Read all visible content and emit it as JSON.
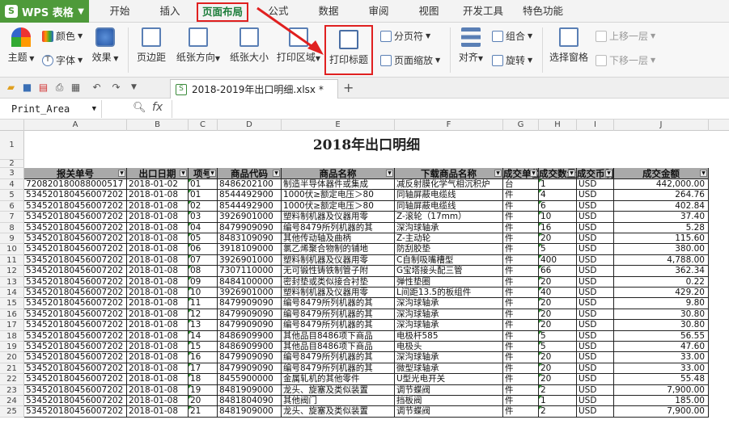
{
  "app": {
    "name": "WPS 表格"
  },
  "menu": {
    "tabs": [
      "开始",
      "插入",
      "页面布局",
      "公式",
      "数据",
      "审阅",
      "视图",
      "开发工具",
      "特色功能"
    ],
    "active_tab": "页面布局"
  },
  "ribbon": {
    "theme": "主题",
    "colors": "颜色",
    "fonts": "字体",
    "effects": "效果",
    "margins": "页边距",
    "orientation": "纸张方向",
    "size": "纸张大小",
    "print_area": "打印区域",
    "print_titles": "打印标题",
    "page_break": "分页符",
    "page_zoom": "页面缩放",
    "align": "对齐",
    "group": "组合",
    "rotate": "旋转",
    "selection_pane": "选择窗格",
    "bring_forward": "上移一层",
    "send_backward": "下移一层"
  },
  "document": {
    "tab_name": "2018-2019年出口明细.xlsx *"
  },
  "formula_bar": {
    "name_box": "Print_Area",
    "fx": "fx"
  },
  "sheet": {
    "columns": [
      "A",
      "B",
      "C",
      "D",
      "E",
      "F",
      "G",
      "H",
      "I",
      "J"
    ],
    "row_numbers": [
      "1",
      "2",
      "3",
      "4",
      "5",
      "6",
      "7",
      "8",
      "9",
      "10",
      "11",
      "12",
      "13",
      "14",
      "15",
      "16",
      "17",
      "18",
      "19",
      "20",
      "21",
      "22",
      "23",
      "24",
      "25"
    ],
    "title": "2018年出口明细",
    "headers": [
      "报关单号",
      "出口日期",
      "项号",
      "商品代码",
      "商品名称",
      "下载商品名称",
      "成交单位",
      "成交数量",
      "成交币制",
      "成交金额"
    ],
    "rows": [
      [
        "720820180088000517",
        "2018-01-02",
        "01",
        "8486202100",
        "制造半导体器件或集成",
        "减反射膜化学气相沉积炉",
        "台",
        "1",
        "USD",
        "442,000.00"
      ],
      [
        "534520180456007202",
        "2018-01-08",
        "01",
        "8544492900",
        "1000伏≥额定电压＞80",
        "同轴屏蔽电缆线",
        "件",
        "4",
        "USD",
        "264.76"
      ],
      [
        "534520180456007202",
        "2018-01-08",
        "02",
        "8544492900",
        "1000伏≥额定电压＞80",
        "同轴屏蔽电缆线",
        "件",
        "6",
        "USD",
        "402.84"
      ],
      [
        "534520180456007202",
        "2018-01-08",
        "03",
        "3926901000",
        "塑料制机器及仪器用零",
        "Z-滚轮（17mm）",
        "件",
        "10",
        "USD",
        "37.40"
      ],
      [
        "534520180456007202",
        "2018-01-08",
        "04",
        "8479909090",
        "编号8479所列机器的其",
        "深沟球轴承",
        "件",
        "16",
        "USD",
        "5.28"
      ],
      [
        "534520180456007202",
        "2018-01-08",
        "05",
        "8483109090",
        "其他传动轴及曲柄",
        "Z-主动轮",
        "件",
        "20",
        "USD",
        "115.60"
      ],
      [
        "534520180456007202",
        "2018-01-08",
        "06",
        "3918109000",
        "氯乙烯聚合物制的铺地",
        "防刮胶垫",
        "件",
        "5",
        "USD",
        "380.00"
      ],
      [
        "534520180456007202",
        "2018-01-08",
        "07",
        "3926901000",
        "塑料制机器及仪器用零",
        "C自制吸嘴槽型",
        "件",
        "400",
        "USD",
        "4,788.00"
      ],
      [
        "534520180456007202",
        "2018-01-08",
        "08",
        "7307110000",
        "无可锻性铸铁制管子附",
        "G宝塔接头配三管",
        "件",
        "66",
        "USD",
        "362.34"
      ],
      [
        "534520180456007202",
        "2018-01-08",
        "09",
        "8484100000",
        "密封垫或类似接合衬垫",
        "弹性垫圈",
        "件",
        "20",
        "USD",
        "0.22"
      ],
      [
        "534520180456007202",
        "2018-01-08",
        "10",
        "3926901000",
        "塑料制机器及仪器用零",
        "L间距13.5的板组件",
        "件",
        "40",
        "USD",
        "429.20"
      ],
      [
        "534520180456007202",
        "2018-01-08",
        "11",
        "8479909090",
        "编号8479所列机器的其",
        "深沟球轴承",
        "件",
        "20",
        "USD",
        "9.80"
      ],
      [
        "534520180456007202",
        "2018-01-08",
        "12",
        "8479909090",
        "编号8479所列机器的其",
        "深沟球轴承",
        "件",
        "20",
        "USD",
        "30.80"
      ],
      [
        "534520180456007202",
        "2018-01-08",
        "13",
        "8479909090",
        "编号8479所列机器的其",
        "深沟球轴承",
        "件",
        "20",
        "USD",
        "30.80"
      ],
      [
        "534520180456007202",
        "2018-01-08",
        "14",
        "8486909900",
        "其他品目8486项下商品",
        "电极杆585",
        "件",
        "5",
        "USD",
        "56.55"
      ],
      [
        "534520180456007202",
        "2018-01-08",
        "15",
        "8486909900",
        "其他品目8486项下商品",
        "电极头",
        "件",
        "5",
        "USD",
        "47.60"
      ],
      [
        "534520180456007202",
        "2018-01-08",
        "16",
        "8479909090",
        "编号8479所列机器的其",
        "深沟球轴承",
        "件",
        "20",
        "USD",
        "33.00"
      ],
      [
        "534520180456007202",
        "2018-01-08",
        "17",
        "8479909090",
        "编号8479所列机器的其",
        "微型球轴承",
        "件",
        "20",
        "USD",
        "33.00"
      ],
      [
        "534520180456007202",
        "2018-01-08",
        "18",
        "8455900000",
        "金属轧机的其他零件",
        "U型光电开关",
        "件",
        "20",
        "USD",
        "55.48"
      ],
      [
        "534520180456007202",
        "2018-01-08",
        "19",
        "8481909000",
        "龙头、旋塞及类似装置",
        "调节蝶阀",
        "件",
        "2",
        "USD",
        "7,900.00"
      ],
      [
        "534520180456007202",
        "2018-01-08",
        "20",
        "8481804090",
        "其他阀门",
        "挡板阀",
        "件",
        "1",
        "USD",
        "185.00"
      ],
      [
        "534520180456007202",
        "2018-01-08",
        "21",
        "8481909000",
        "龙头、旋塞及类似装置",
        "调节蝶阀",
        "件",
        "2",
        "USD",
        "7,900.00"
      ]
    ]
  },
  "colors": {
    "accent_green": "#1b7d3a",
    "highlight_red": "#e02020",
    "header_gray": "#a9a9a9"
  }
}
